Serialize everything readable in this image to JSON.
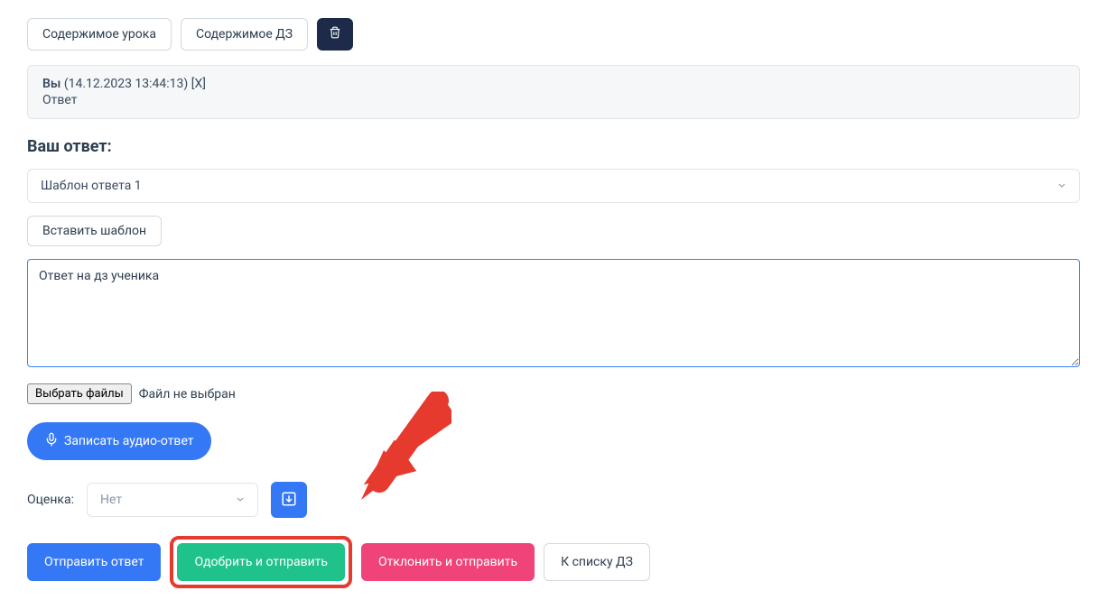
{
  "toolbar": {
    "lesson_content": "Содержимое урока",
    "homework_content": "Содержимое ДЗ"
  },
  "message": {
    "author": "Вы",
    "timestamp": "(14.12.2023 13:44:13)",
    "delete_marker": "[X]",
    "body": "Ответ"
  },
  "response": {
    "heading": "Ваш ответ:",
    "template_selected": "Шаблон ответа 1",
    "insert_template": "Вставить шаблон",
    "textarea_value": "Ответ на дз ученика",
    "file_button": "Выбрать файлы",
    "file_status": "Файл не выбран",
    "record_audio": "Записать аудио-ответ"
  },
  "grade": {
    "label": "Оценка:",
    "selected": "Нет"
  },
  "actions": {
    "send": "Отправить ответ",
    "approve_send": "Одобрить и отправить",
    "reject_send": "Отклонить и отправить",
    "to_list": "К списку ДЗ"
  }
}
